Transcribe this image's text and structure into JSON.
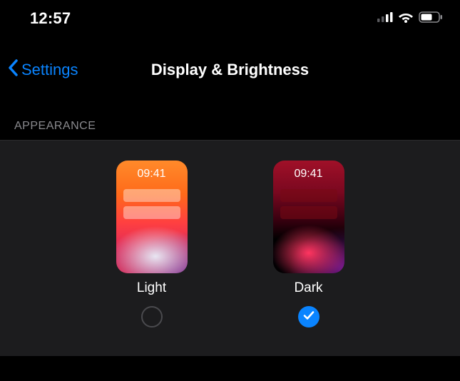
{
  "status_bar": {
    "time": "12:57"
  },
  "nav": {
    "back_label": "Settings",
    "title": "Display & Brightness"
  },
  "section": {
    "header": "APPEARANCE",
    "preview_time": "09:41",
    "options": {
      "light": {
        "label": "Light",
        "selected": false
      },
      "dark": {
        "label": "Dark",
        "selected": true
      }
    }
  },
  "colors": {
    "accent": "#0a84ff",
    "panel": "#1c1c1e"
  }
}
